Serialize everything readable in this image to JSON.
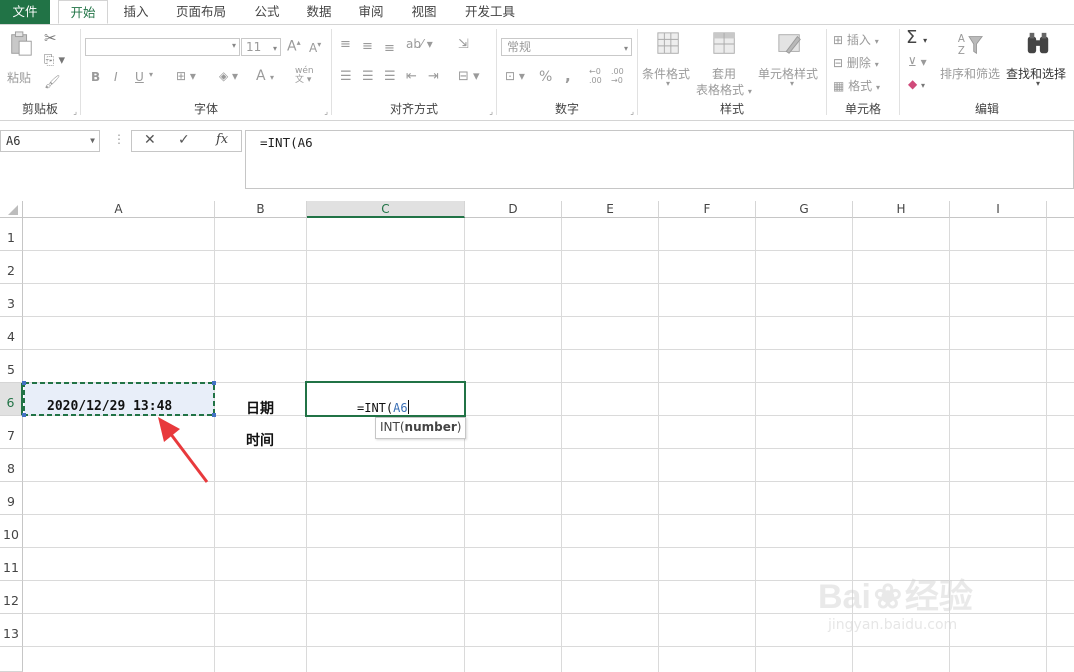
{
  "tabs": [
    {
      "id": "file",
      "label": "文件"
    },
    {
      "id": "home",
      "label": "开始"
    },
    {
      "id": "insert",
      "label": "插入"
    },
    {
      "id": "layout",
      "label": "页面布局"
    },
    {
      "id": "formulas",
      "label": "公式"
    },
    {
      "id": "data",
      "label": "数据"
    },
    {
      "id": "review",
      "label": "审阅"
    },
    {
      "id": "view",
      "label": "视图"
    },
    {
      "id": "developer",
      "label": "开发工具"
    }
  ],
  "ribbon": {
    "clipboard": {
      "label": "剪贴板",
      "paste": "粘贴"
    },
    "font": {
      "label": "字体",
      "size": "11",
      "bold": "B",
      "italic": "I",
      "underline": "U",
      "grow": "A",
      "shrink": "A",
      "color": "A",
      "phonetic": "wén"
    },
    "align": {
      "label": "对齐方式"
    },
    "number": {
      "label": "数字",
      "format": "常规",
      "percent": "%",
      "comma": ",",
      "inc_decimal": "←0\n.00",
      "dec_decimal": ".00\n→0"
    },
    "styles": {
      "label": "样式",
      "cond": "条件格式",
      "table1": "套用",
      "table2": "表格格式",
      "cell_styles": "单元格样式"
    },
    "cells": {
      "label": "单元格",
      "insert": "插入",
      "delete": "删除",
      "format": "格式"
    },
    "editing": {
      "label": "编辑",
      "sum": "Σ",
      "sort": "排序和筛选",
      "find": "查找和选择"
    }
  },
  "formula_bar": {
    "name_box": "A6",
    "cancel": "✕",
    "confirm": "✓",
    "fx": "fx",
    "formula": "=INT(A6"
  },
  "columns": [
    "A",
    "B",
    "C",
    "D",
    "E",
    "F",
    "G",
    "H",
    "I"
  ],
  "rows": [
    "1",
    "2",
    "3",
    "4",
    "5",
    "6",
    "7",
    "8",
    "9",
    "10",
    "11",
    "12",
    "13"
  ],
  "cells": {
    "A6": "2020/12/29 13:48",
    "B6": "日期",
    "B7": "时间",
    "C6_prefix": "=INT(",
    "C6_ref": "A6"
  },
  "tooltip": {
    "fn": "INT(",
    "arg": "number",
    "close": ")"
  },
  "watermark": {
    "brand_left": "Bai",
    "brand_right": "经验",
    "url": "jingyan.baidu.com"
  },
  "colors": {
    "accent": "#217346",
    "ref_blue": "#3a6fb5",
    "ref_box": "#4472c4",
    "arrow": "#e8393c"
  }
}
